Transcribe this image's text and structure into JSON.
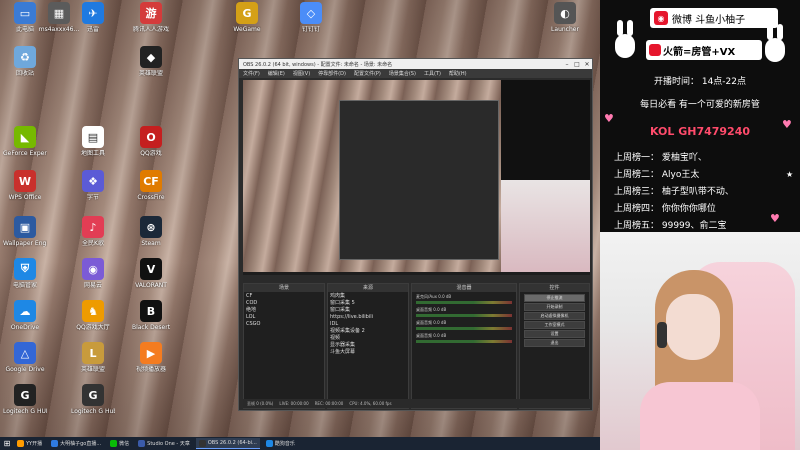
{
  "desktop": {
    "icons": [
      {
        "label": "此电脑",
        "color": "#3a7bd5",
        "glyph": "▭"
      },
      {
        "label": "ms4axxx46...",
        "color": "#5b5b5b",
        "glyph": "▦"
      },
      {
        "label": "迅雷",
        "color": "#1f7ae0",
        "glyph": "✈"
      },
      {
        "label": "腾讯人人游戏",
        "color": "#d43b3b",
        "glyph": "游"
      },
      {
        "label": "WeGame",
        "color": "#d4a017",
        "glyph": "G"
      },
      {
        "label": "钉钉钉",
        "color": "#4b8df8",
        "glyph": "◇"
      },
      {
        "label": "回收站",
        "color": "#6fa8dc",
        "glyph": "♻"
      },
      {
        "label": "英雄联盟",
        "color": "#222",
        "glyph": "◆"
      },
      {
        "label": "GeForce Experience",
        "color": "#76b900",
        "glyph": "◣"
      },
      {
        "label": "地图工具",
        "color": "#ffffff",
        "glyph": "▤"
      },
      {
        "label": "QQ游戏",
        "color": "#c51f1f",
        "glyph": "O"
      },
      {
        "label": "WPS Office",
        "color": "#c9302c",
        "glyph": "W"
      },
      {
        "label": "字节",
        "color": "#5b5bd6",
        "glyph": "❖"
      },
      {
        "label": "CrossFire",
        "color": "#e07b00",
        "glyph": "CF"
      },
      {
        "label": "Wallpaper Engine",
        "color": "#2c5aa0",
        "glyph": "▣"
      },
      {
        "label": "全民K歌",
        "color": "#e23d54",
        "glyph": "♪"
      },
      {
        "label": "Steam",
        "color": "#1b2838",
        "glyph": "⊛"
      },
      {
        "label": "电脑管家",
        "color": "#1e88e5",
        "glyph": "⛨"
      },
      {
        "label": "网易云",
        "color": "#7b5bd6",
        "glyph": "◉"
      },
      {
        "label": "VALORANT",
        "color": "#111",
        "glyph": "V"
      },
      {
        "label": "OneDrive",
        "color": "#1e88e5",
        "glyph": "☁"
      },
      {
        "label": "QQ游戏大厅",
        "color": "#ee9b00",
        "glyph": "♞"
      },
      {
        "label": "Black Desert",
        "color": "#111",
        "glyph": "B"
      },
      {
        "label": "Google Drive",
        "color": "#3367d6",
        "glyph": "△"
      },
      {
        "label": "英雄联盟",
        "color": "#c89b3c",
        "glyph": "L"
      },
      {
        "label": "视频播放器",
        "color": "#f47c20",
        "glyph": "▶"
      },
      {
        "label": "Logitech G HUB",
        "color": "#222",
        "glyph": "G"
      },
      {
        "label": "Logitech G Hub",
        "color": "#333",
        "glyph": "G"
      },
      {
        "label": "Launcher",
        "color": "#555",
        "glyph": "◐"
      }
    ]
  },
  "obs": {
    "title": "OBS 26.0.2 (64 bit, windows) - 配置文件: 未命名 - 场景: 未命名",
    "menu": [
      "文件(F)",
      "编辑(E)",
      "视图(V)",
      "停靠部件(D)",
      "配置文件(P)",
      "场景集合(S)",
      "工具(T)",
      "帮助(H)"
    ],
    "scenes_title": "场景",
    "scenes": [
      "CF",
      "COD",
      "绝地",
      "LOL",
      "CSGO"
    ],
    "sources_title": "来源",
    "sources": [
      "鸡肉集",
      "窗口采集 5",
      "窗口采集",
      "https://live.bilibili",
      "IDL",
      "视频采集设备 2",
      "视频",
      "显示器采集",
      "斗鱼大屏幕"
    ],
    "mixer_title": "混音器",
    "mixer": [
      {
        "name": "麦克风/Aux",
        "db": "0.0 dB"
      },
      {
        "name": "桌面音频",
        "db": "0.0 dB"
      },
      {
        "name": "桌面音频",
        "db": "0.0 dB"
      },
      {
        "name": "桌面音频",
        "db": "0.0 dB"
      }
    ],
    "controls_title": "控件",
    "controls": [
      "停止推流",
      "开始录制",
      "启动虚拟摄像机",
      "工作室模式",
      "设置",
      "退出"
    ],
    "status": [
      "丢帧 0 (0.0%)",
      "LIVE: 00:00:00",
      "REC: 00:00:00",
      "CPU: 4.0%, 60.00 fps"
    ]
  },
  "stream": {
    "weibo_label": "微博 斗鱼小柚子",
    "fire_label": "火箭=房管+VX",
    "time_label": "开播时间： 14点-22点",
    "tagline": "每日必看 有一个可爱的新房管",
    "room": "KOL GH7479240",
    "gifts": [
      "上周榜一： 爱柚宝吖、",
      "上周榜二： Alyo王太",
      "上周榜三： 柚子型叭带不动、",
      "上周榜四： 你你你你哪位",
      "上周榜五： 99999、俞二宝"
    ]
  },
  "taskbar": {
    "start_icon": "windows-logo",
    "items": [
      {
        "label": "YY开播",
        "color": "#ff9c00"
      },
      {
        "label": "大明柚子go直播...",
        "color": "#2f7ae0"
      },
      {
        "label": "微信",
        "color": "#09bb07"
      },
      {
        "label": "Studio One - 天章",
        "color": "#3b5ba9"
      },
      {
        "label": "OBS 26.0.2 (64-bi...",
        "color": "#333333"
      },
      {
        "label": "酷狗音乐",
        "color": "#1e88e5"
      }
    ]
  }
}
